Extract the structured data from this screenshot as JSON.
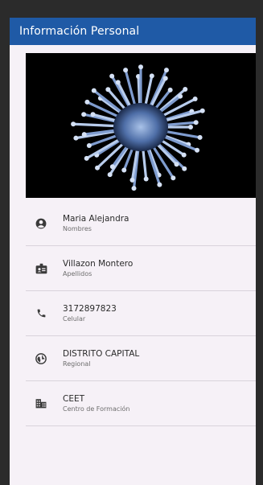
{
  "appbar": {
    "title": "Información Personal",
    "color": "#1f5aa6"
  },
  "hero": {
    "image": "virus-image"
  },
  "list": [
    {
      "icon": "account-circle-icon",
      "primary": "Maria Alejandra",
      "secondary": "Nombres"
    },
    {
      "icon": "badge-icon",
      "primary": "Villazon Montero",
      "secondary": "Apellidos"
    },
    {
      "icon": "phone-icon",
      "primary": "3172897823",
      "secondary": "Celular"
    },
    {
      "icon": "globe-icon",
      "primary": "DISTRITO CAPITAL",
      "secondary": "Regional"
    },
    {
      "icon": "business-icon",
      "primary": "CEET",
      "secondary": "Centro de Formación"
    }
  ]
}
